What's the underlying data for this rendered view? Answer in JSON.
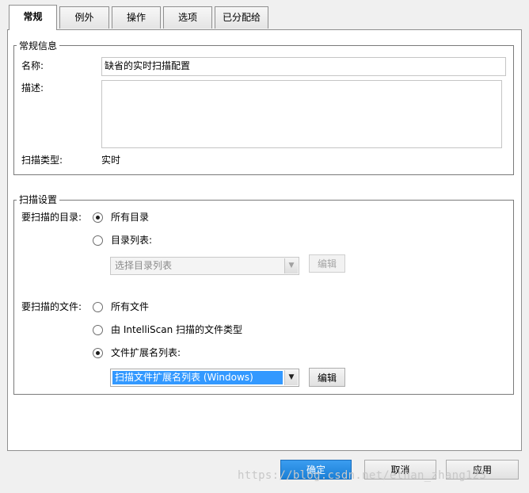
{
  "tabs": [
    {
      "label": "常规",
      "active": true
    },
    {
      "label": "例外",
      "active": false
    },
    {
      "label": "操作",
      "active": false
    },
    {
      "label": "选项",
      "active": false
    },
    {
      "label": "已分配给",
      "active": false
    }
  ],
  "general_info": {
    "legend": "常规信息",
    "name_label": "名称:",
    "name_value": "缺省的实时扫描配置",
    "desc_label": "描述:",
    "desc_value": "",
    "scan_type_label": "扫描类型:",
    "scan_type_value": "实时"
  },
  "scan_settings": {
    "legend": "扫描设置",
    "dirs_label": "要扫描的目录:",
    "dirs_options": [
      {
        "label": "所有目录",
        "checked": true
      },
      {
        "label": "目录列表:",
        "checked": false
      }
    ],
    "dir_list_combo": "选择目录列表",
    "dir_edit_button": "编辑",
    "files_label": "要扫描的文件:",
    "files_options": [
      {
        "label": "所有文件",
        "checked": false
      },
      {
        "label": "由 IntelliScan 扫描的文件类型",
        "checked": false
      },
      {
        "label": "文件扩展名列表:",
        "checked": true
      }
    ],
    "ext_list_combo": "扫描文件扩展名列表 (Windows)",
    "ext_edit_button": "编辑"
  },
  "footer": {
    "ok_button": "确定",
    "cancel_button": "取消",
    "apply_button": "应用"
  },
  "watermark": "https://blog.csdn.net/ethan_zhang123",
  "colors": {
    "accent": "#1a7fd6",
    "selection": "#3399ff"
  }
}
